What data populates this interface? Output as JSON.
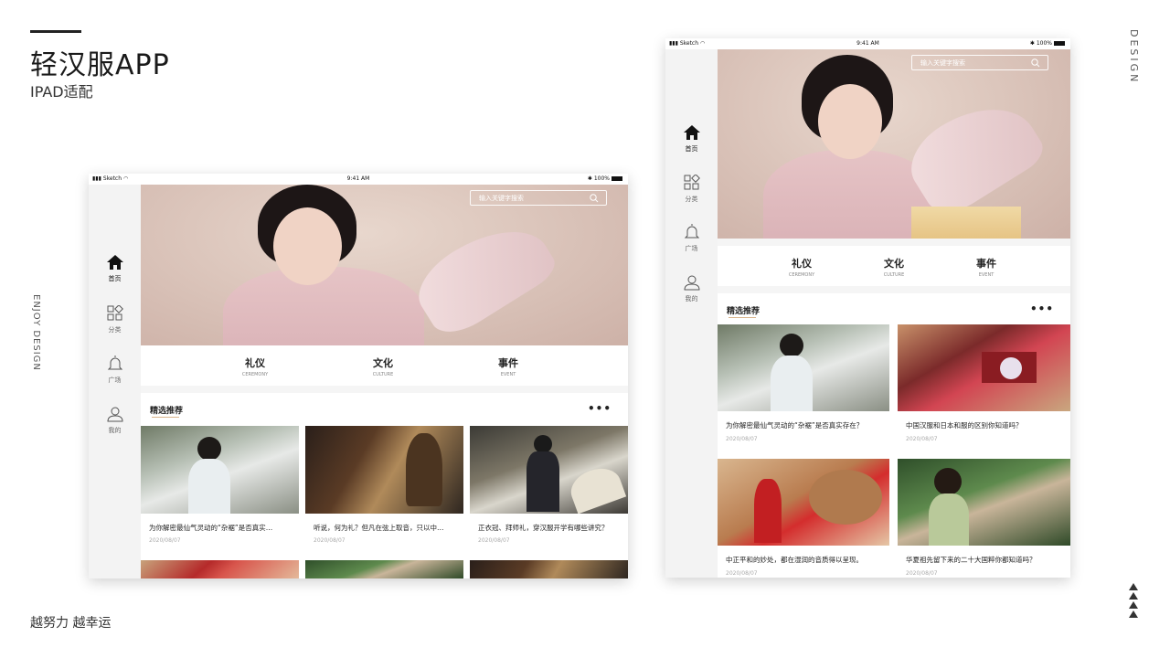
{
  "presentation": {
    "title": "轻汉服APP",
    "subtitle": "IPAD适配",
    "side_right": "DESIGN",
    "side_left": "ENJOY DESIGN",
    "slogan": "越努力 越幸运"
  },
  "status": {
    "carrier": "Sketch",
    "time": "9:41 AM",
    "battery": "100%"
  },
  "search": {
    "placeholder": "输入关键字搜索"
  },
  "nav": [
    {
      "label": "首页",
      "icon": "home-icon"
    },
    {
      "label": "分类",
      "icon": "category-icon"
    },
    {
      "label": "广场",
      "icon": "bell-icon"
    },
    {
      "label": "我的",
      "icon": "user-icon"
    }
  ],
  "categories": [
    {
      "zh": "礼仪",
      "en": "CEREMONY"
    },
    {
      "zh": "文化",
      "en": "CULTURE"
    },
    {
      "zh": "事件",
      "en": "EVENT"
    }
  ],
  "featured": {
    "title": "精选推荐",
    "more": "•••"
  },
  "landscape_cards": [
    {
      "caption": "为你解密最仙气灵动的“杂裾”是否真实…",
      "date": "2020/08/07"
    },
    {
      "caption": "听说，何为礼？但凡在弦上取音，只以中…",
      "date": "2020/08/07"
    },
    {
      "caption": "正衣冠、拜师礼，穿汉服开学有哪些讲究？",
      "date": "2020/08/07"
    }
  ],
  "portrait_cards": [
    {
      "caption": "为你解密最仙气灵动的“杂裾”是否真实存在？",
      "date": "2020/08/07"
    },
    {
      "caption": "中国汉服和日本和服的区别你知道吗？",
      "date": "2020/08/07"
    },
    {
      "caption": "中正平和的妙处，都在湿润的音质得以呈现。",
      "date": "2020/08/07"
    },
    {
      "caption": "华夏祖先留下来的二十大国粹你都知道吗？",
      "date": "2020/08/07"
    }
  ],
  "colors": {
    "accent_underline": "#d9b48a",
    "sidebar_bg": "#f3f3f3",
    "page_bg": "#ffffff"
  }
}
